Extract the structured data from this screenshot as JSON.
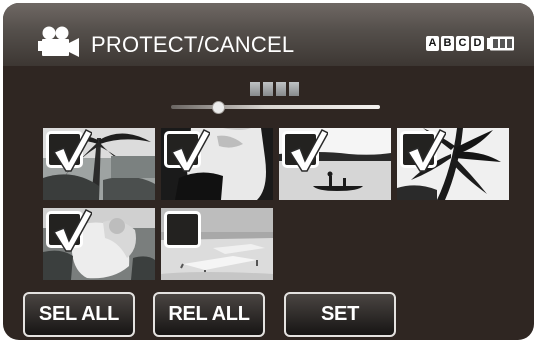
{
  "header": {
    "title": "PROTECT/CANCEL",
    "mode_icon": "video-camera-icon",
    "battery_letters": [
      "A",
      "B",
      "C",
      "D"
    ],
    "battery_icon": "battery-icon"
  },
  "thumbnails": [
    {
      "name": "palm-tree",
      "checked": true
    },
    {
      "name": "person-white-shirt",
      "checked": true
    },
    {
      "name": "canoe-lake",
      "checked": true
    },
    {
      "name": "palm-leaves",
      "checked": true
    },
    {
      "name": "wedding-couple",
      "checked": true
    },
    {
      "name": "beach-chairs",
      "checked": false
    }
  ],
  "buttons": {
    "select_all": "SEL ALL",
    "release_all": "REL ALL",
    "set": "SET"
  },
  "colors": {
    "background": "#2f2622",
    "header": "#55504c",
    "text": "#ffffff"
  }
}
